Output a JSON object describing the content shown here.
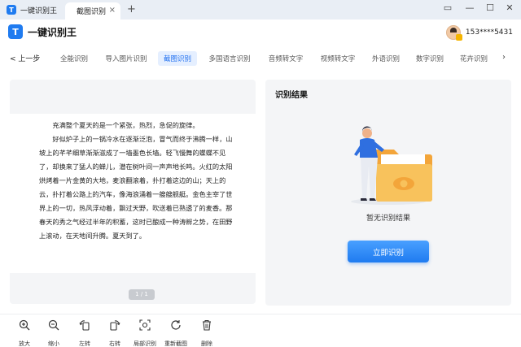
{
  "window": {
    "app_tab_label": "一键识别王",
    "doc_tab_label": "截图识别",
    "tab_close": "×",
    "add_tab": "+",
    "controls": [
      "▭",
      "—",
      "☐",
      "✕"
    ]
  },
  "header": {
    "brand_name": "一键识别王",
    "user_phone": "153****5431"
  },
  "nav": {
    "back_label": "< 上一步",
    "tabs": [
      "全能识别",
      "导入图片识别",
      "截图识别",
      "多国语言识别",
      "音频转文字",
      "视频转文字",
      "外语识别",
      "数字识别",
      "花卉识别"
    ],
    "active_index": 2,
    "more": "›"
  },
  "preview": {
    "paragraphs": [
      "充满整个夏天的是一个紧张，热烈，急促的旋律。",
      "好似炉子上的一锅冷水在逐渐泛泡，冒气而终于沸腾一样，山坡上的芊芊细草渐渐滋成了一墙墨色长墙。轻飞慢舞的蝶蝶不见了，却换来了猛人的蝉儿，潜在树叶间一声声地长鸣。火红的太阳烘烤着一片金黄的大地，麦浪翻滚着，扑打着这边的山；天上的云，扑打着公路上的汽车，像海浪涌着一艘艘舰艇。金色主宰了世界上的一切，热风浮动着，飘过天野，吹送着已熟透了的麦香。那春天的秀之气经过半年的积蓄，这时已酿成一种涛孵之势，在田野上滚动，在天地间升腾。夏天到了。"
    ],
    "page_indicator": "1 / 1"
  },
  "result": {
    "title": "识别结果",
    "empty_text": "暂无识别结果",
    "recognize_label": "立即识别"
  },
  "toolbar": {
    "items": [
      "放大",
      "缩小",
      "左转",
      "右转",
      "局部识别",
      "重新截图",
      "删除"
    ]
  },
  "colors": {
    "accent": "#1f7bf0",
    "active_tab_bg": "#e5efff",
    "panel_bg": "#f4f5f7",
    "folder": "#f6b64a"
  }
}
